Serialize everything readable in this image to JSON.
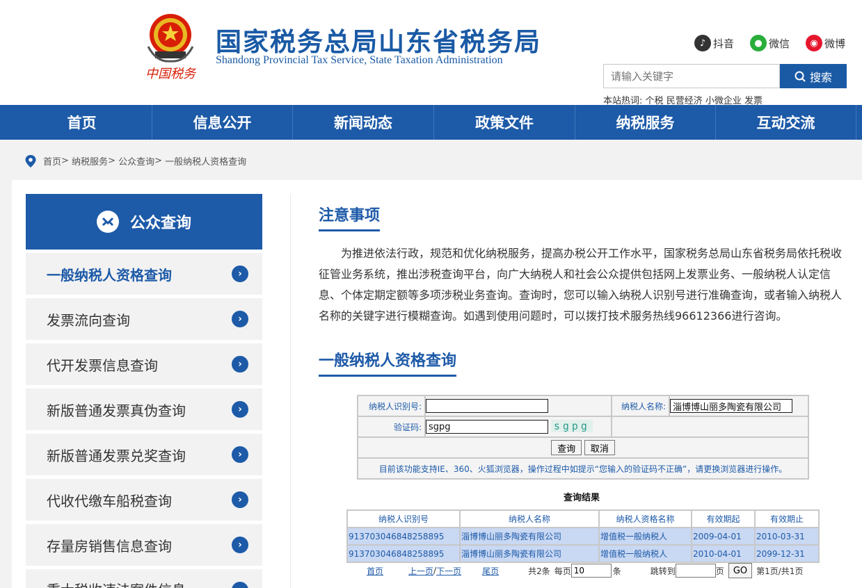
{
  "header": {
    "title": "国家税务总局山东省税务局",
    "subtitle": "Shandong Provincial Tax Service, State Taxation Administration",
    "emblem_caption": "中国税务",
    "social": [
      {
        "label": "抖音",
        "icon": "douyin-icon",
        "color": "#333333"
      },
      {
        "label": "微信",
        "icon": "wechat-icon",
        "color": "#2aae3b"
      },
      {
        "label": "微博",
        "icon": "weibo-icon",
        "color": "#e6162d"
      }
    ],
    "search": {
      "placeholder": "请输入关键字",
      "button": "搜索"
    },
    "hot_label": "本站热词:",
    "hot_words": [
      "个税",
      "民营经济",
      "小微企业",
      "发票"
    ]
  },
  "nav": [
    "首页",
    "信息公开",
    "新闻动态",
    "政策文件",
    "纳税服务",
    "互动交流"
  ],
  "breadcrumb": [
    "首页",
    "纳税服务",
    "公众查询",
    "一般纳税人资格查询"
  ],
  "sidebar": {
    "title": "公众查询",
    "items": [
      "一般纳税人资格查询",
      "发票流向查询",
      "代开发票信息查询",
      "新版普通发票真伪查询",
      "新版普通发票兑奖查询",
      "代收代缴车船税查询",
      "存量房销售信息查询",
      "重大税收违法案件信息"
    ],
    "active_index": 0
  },
  "notice": {
    "title": "注意事项",
    "text": "为推进依法行政，规范和优化纳税服务，提高办税公开工作水平，国家税务总局山东省税务局依托税收征管业务系统，推出涉税查询平台，向广大纳税人和社会公众提供包括网上发票业务、一般纳税人认定信息、个体定期定额等多项涉税业务查询。查询时，您可以输入纳税人识别号进行准确查询，或者输入纳税人名称的关键字进行模糊查询。如遇到使用问题时，可以拨打技术服务热线96612366进行咨询。"
  },
  "query": {
    "title": "一般纳税人资格查询",
    "id_label": "纳税人识别号:",
    "id_value": "",
    "name_label": "纳税人名称:",
    "name_value": "淄博博山丽多陶瓷有限公司",
    "captcha_label": "验证码:",
    "captcha_value": "sgpg",
    "captcha_image_text": "sgpg",
    "query_button": "查询",
    "cancel_button": "取消",
    "tip": "目前该功能支持IE、360、火狐浏览器，操作过程中如提示“您输入的验证码不正确”，请更换浏览器进行操作。"
  },
  "result": {
    "title": "查询结果",
    "columns": [
      "纳税人识别号",
      "纳税人名称",
      "纳税人资格名称",
      "有效期起",
      "有效期止"
    ],
    "rows": [
      [
        "913703046848258895",
        "淄博博山丽多陶瓷有限公司",
        "增值税一般纳税人",
        "2009-04-01",
        "2010-03-31"
      ],
      [
        "913703046848258895",
        "淄博博山丽多陶瓷有限公司",
        "增值税一般纳税人",
        "2010-04-01",
        "2099-12-31"
      ]
    ]
  },
  "pager": {
    "first": "首页",
    "prev": "上一页",
    "sep": "/",
    "next": "下一页",
    "last": "尾页",
    "total": "共2条",
    "per_page_label": "每页",
    "per_page_value": "10",
    "per_page_unit": "条",
    "jump_label": "跳转到",
    "jump_unit": "页",
    "go": "GO",
    "page_info": "第1页/共1页"
  },
  "colors": {
    "primary": "#1d5aa8",
    "row_bg": "#c9d8f3"
  }
}
